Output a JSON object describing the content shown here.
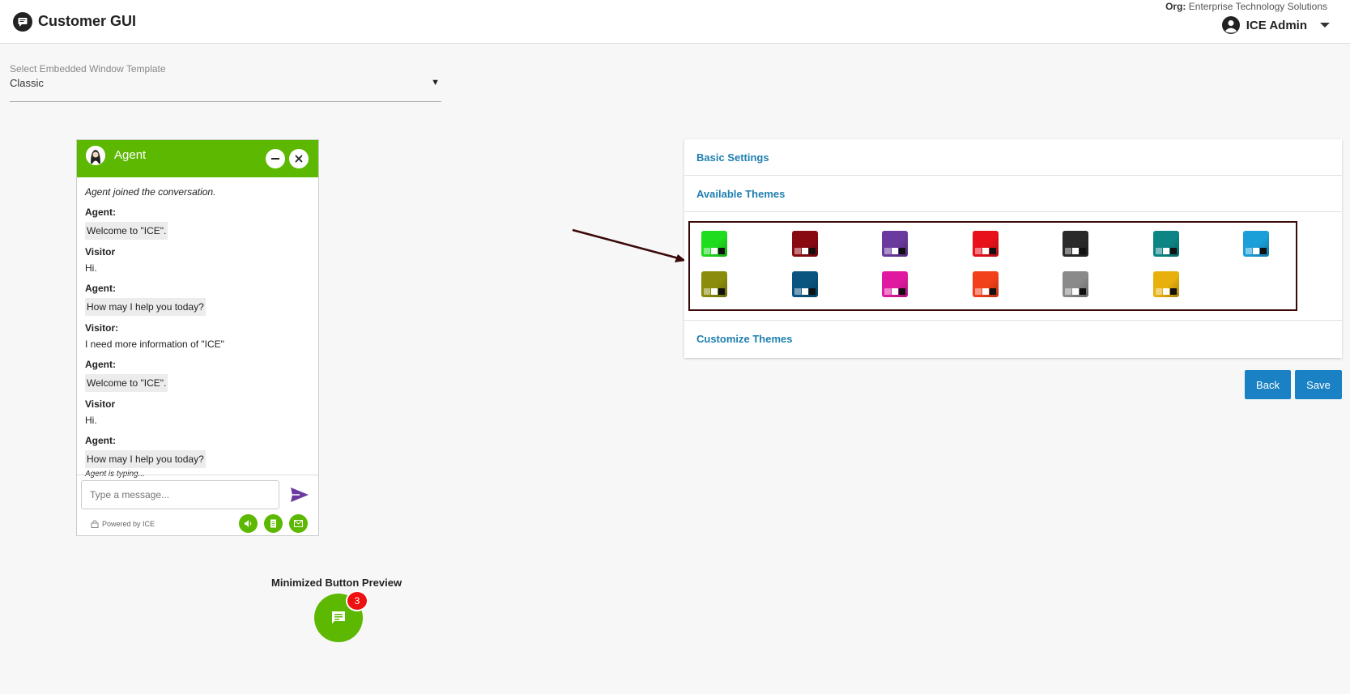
{
  "header": {
    "title": "Customer GUI",
    "org_label": "Org:",
    "org_name": "Enterprise Technology Solutions",
    "user_name": "ICE Admin"
  },
  "template_select": {
    "label": "Select Embedded Window Template",
    "value": "Classic"
  },
  "chat": {
    "title": "Agent",
    "system_message": "Agent joined the conversation.",
    "messages": [
      {
        "who": "Agent:",
        "text": "Welcome to \"ICE\"."
      },
      {
        "who": "Visitor",
        "text": "Hi."
      },
      {
        "who": "Agent:",
        "text": "How may I help you today?"
      },
      {
        "who": "Visitor:",
        "text": "I need more information of \"ICE\""
      },
      {
        "who": "Agent:",
        "text": "Welcome to \"ICE\"."
      },
      {
        "who": "Visitor",
        "text": "Hi."
      },
      {
        "who": "Agent:",
        "text": "How may I help you today?"
      }
    ],
    "typing": "Agent is typing...",
    "input_placeholder": "Type a message...",
    "powered_by": "Powered by ICE"
  },
  "minimized": {
    "label": "Minimized Button Preview",
    "badge": "3"
  },
  "panel": {
    "basic_settings": "Basic Settings",
    "available_themes": "Available Themes",
    "customize_themes": "Customize Themes",
    "themes": [
      {
        "name": "green",
        "color": "#1fdc1f"
      },
      {
        "name": "dark-red",
        "color": "#8a0a12"
      },
      {
        "name": "purple",
        "color": "#6a3a9e"
      },
      {
        "name": "red",
        "color": "#e8101a"
      },
      {
        "name": "black",
        "color": "#2a2a2a"
      },
      {
        "name": "teal",
        "color": "#0d8585"
      },
      {
        "name": "sky-blue",
        "color": "#1a9fd8"
      },
      {
        "name": "olive",
        "color": "#8c8c0c"
      },
      {
        "name": "navy-blue",
        "color": "#0a5580"
      },
      {
        "name": "magenta",
        "color": "#e01aa0"
      },
      {
        "name": "orange-red",
        "color": "#f2401a"
      },
      {
        "name": "gray",
        "color": "#8a8a8a"
      },
      {
        "name": "gold",
        "color": "#e8b00c"
      }
    ]
  },
  "actions": {
    "back": "Back",
    "save": "Save"
  },
  "colors": {
    "chat_green": "#5cb800",
    "link_blue": "#1f7fb0",
    "button_blue": "#1a82c4",
    "badge_red": "#ee1111",
    "highlight_border": "#3a0808"
  }
}
